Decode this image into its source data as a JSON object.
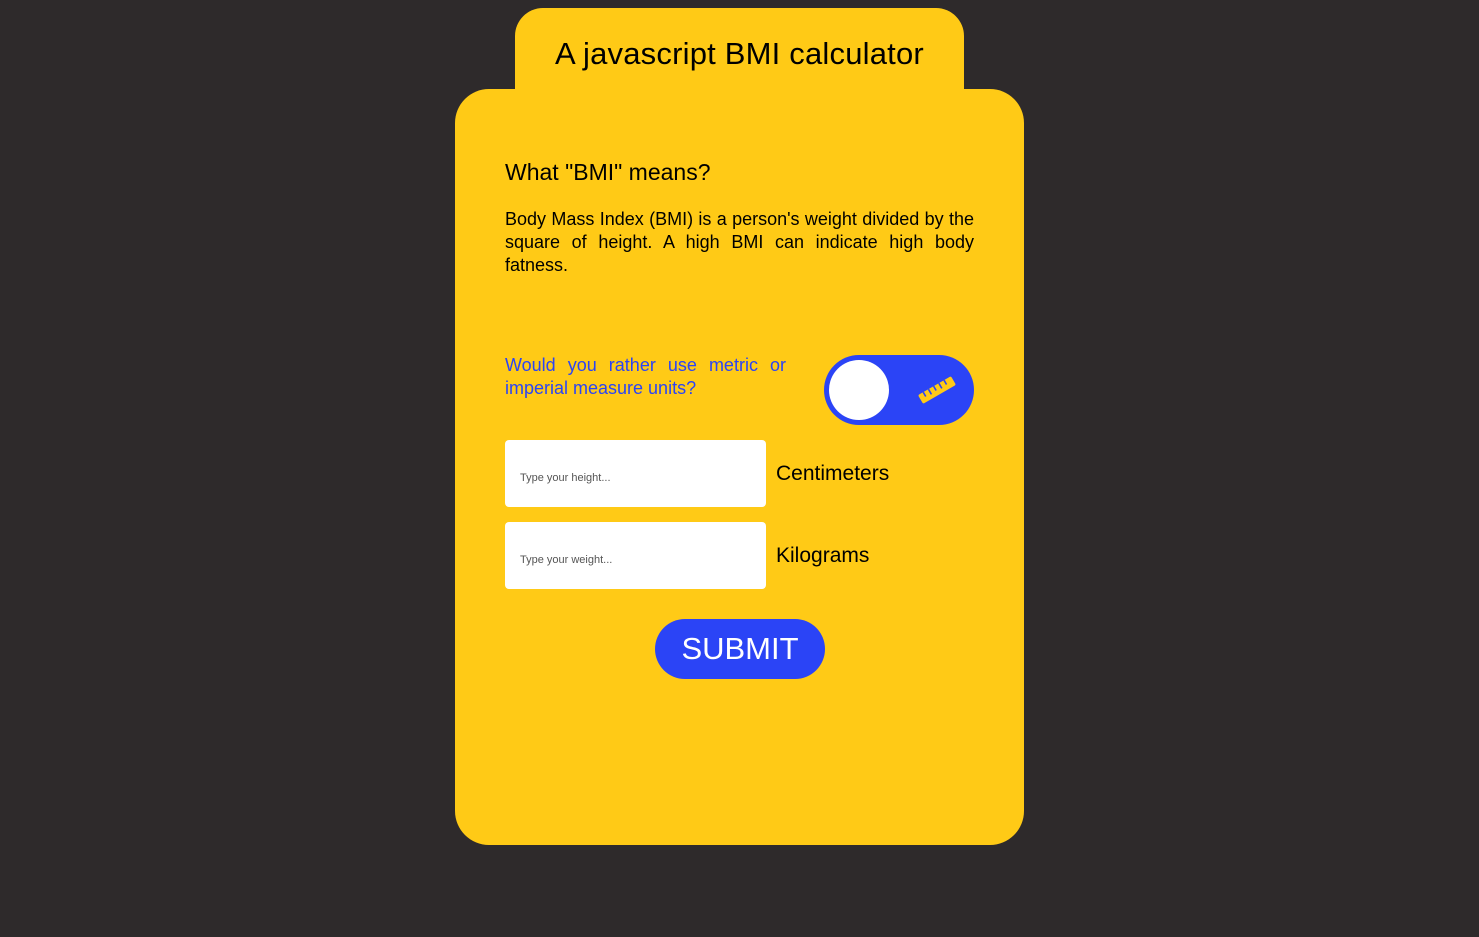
{
  "header": {
    "title": "A javascript BMI calculator"
  },
  "info": {
    "heading": "What \"BMI\" means?",
    "description": "Body Mass Index (BMI) is a person's weight divided by the square of height. A high BMI can indicate high body fatness."
  },
  "units": {
    "question": "Would you rather use metric or imperial measure units?",
    "toggle_state": "metric",
    "toggle_icon": "ruler-icon"
  },
  "form": {
    "height_placeholder": "Type your height...",
    "height_value": "",
    "height_unit": "Centimeters",
    "weight_placeholder": "Type your weight...",
    "weight_value": "",
    "weight_unit": "Kilograms",
    "submit_label": "SUBMIT"
  },
  "colors": {
    "background": "#2e2a2b",
    "card": "#ffca16",
    "accent": "#2b44f6",
    "text": "#000000"
  }
}
